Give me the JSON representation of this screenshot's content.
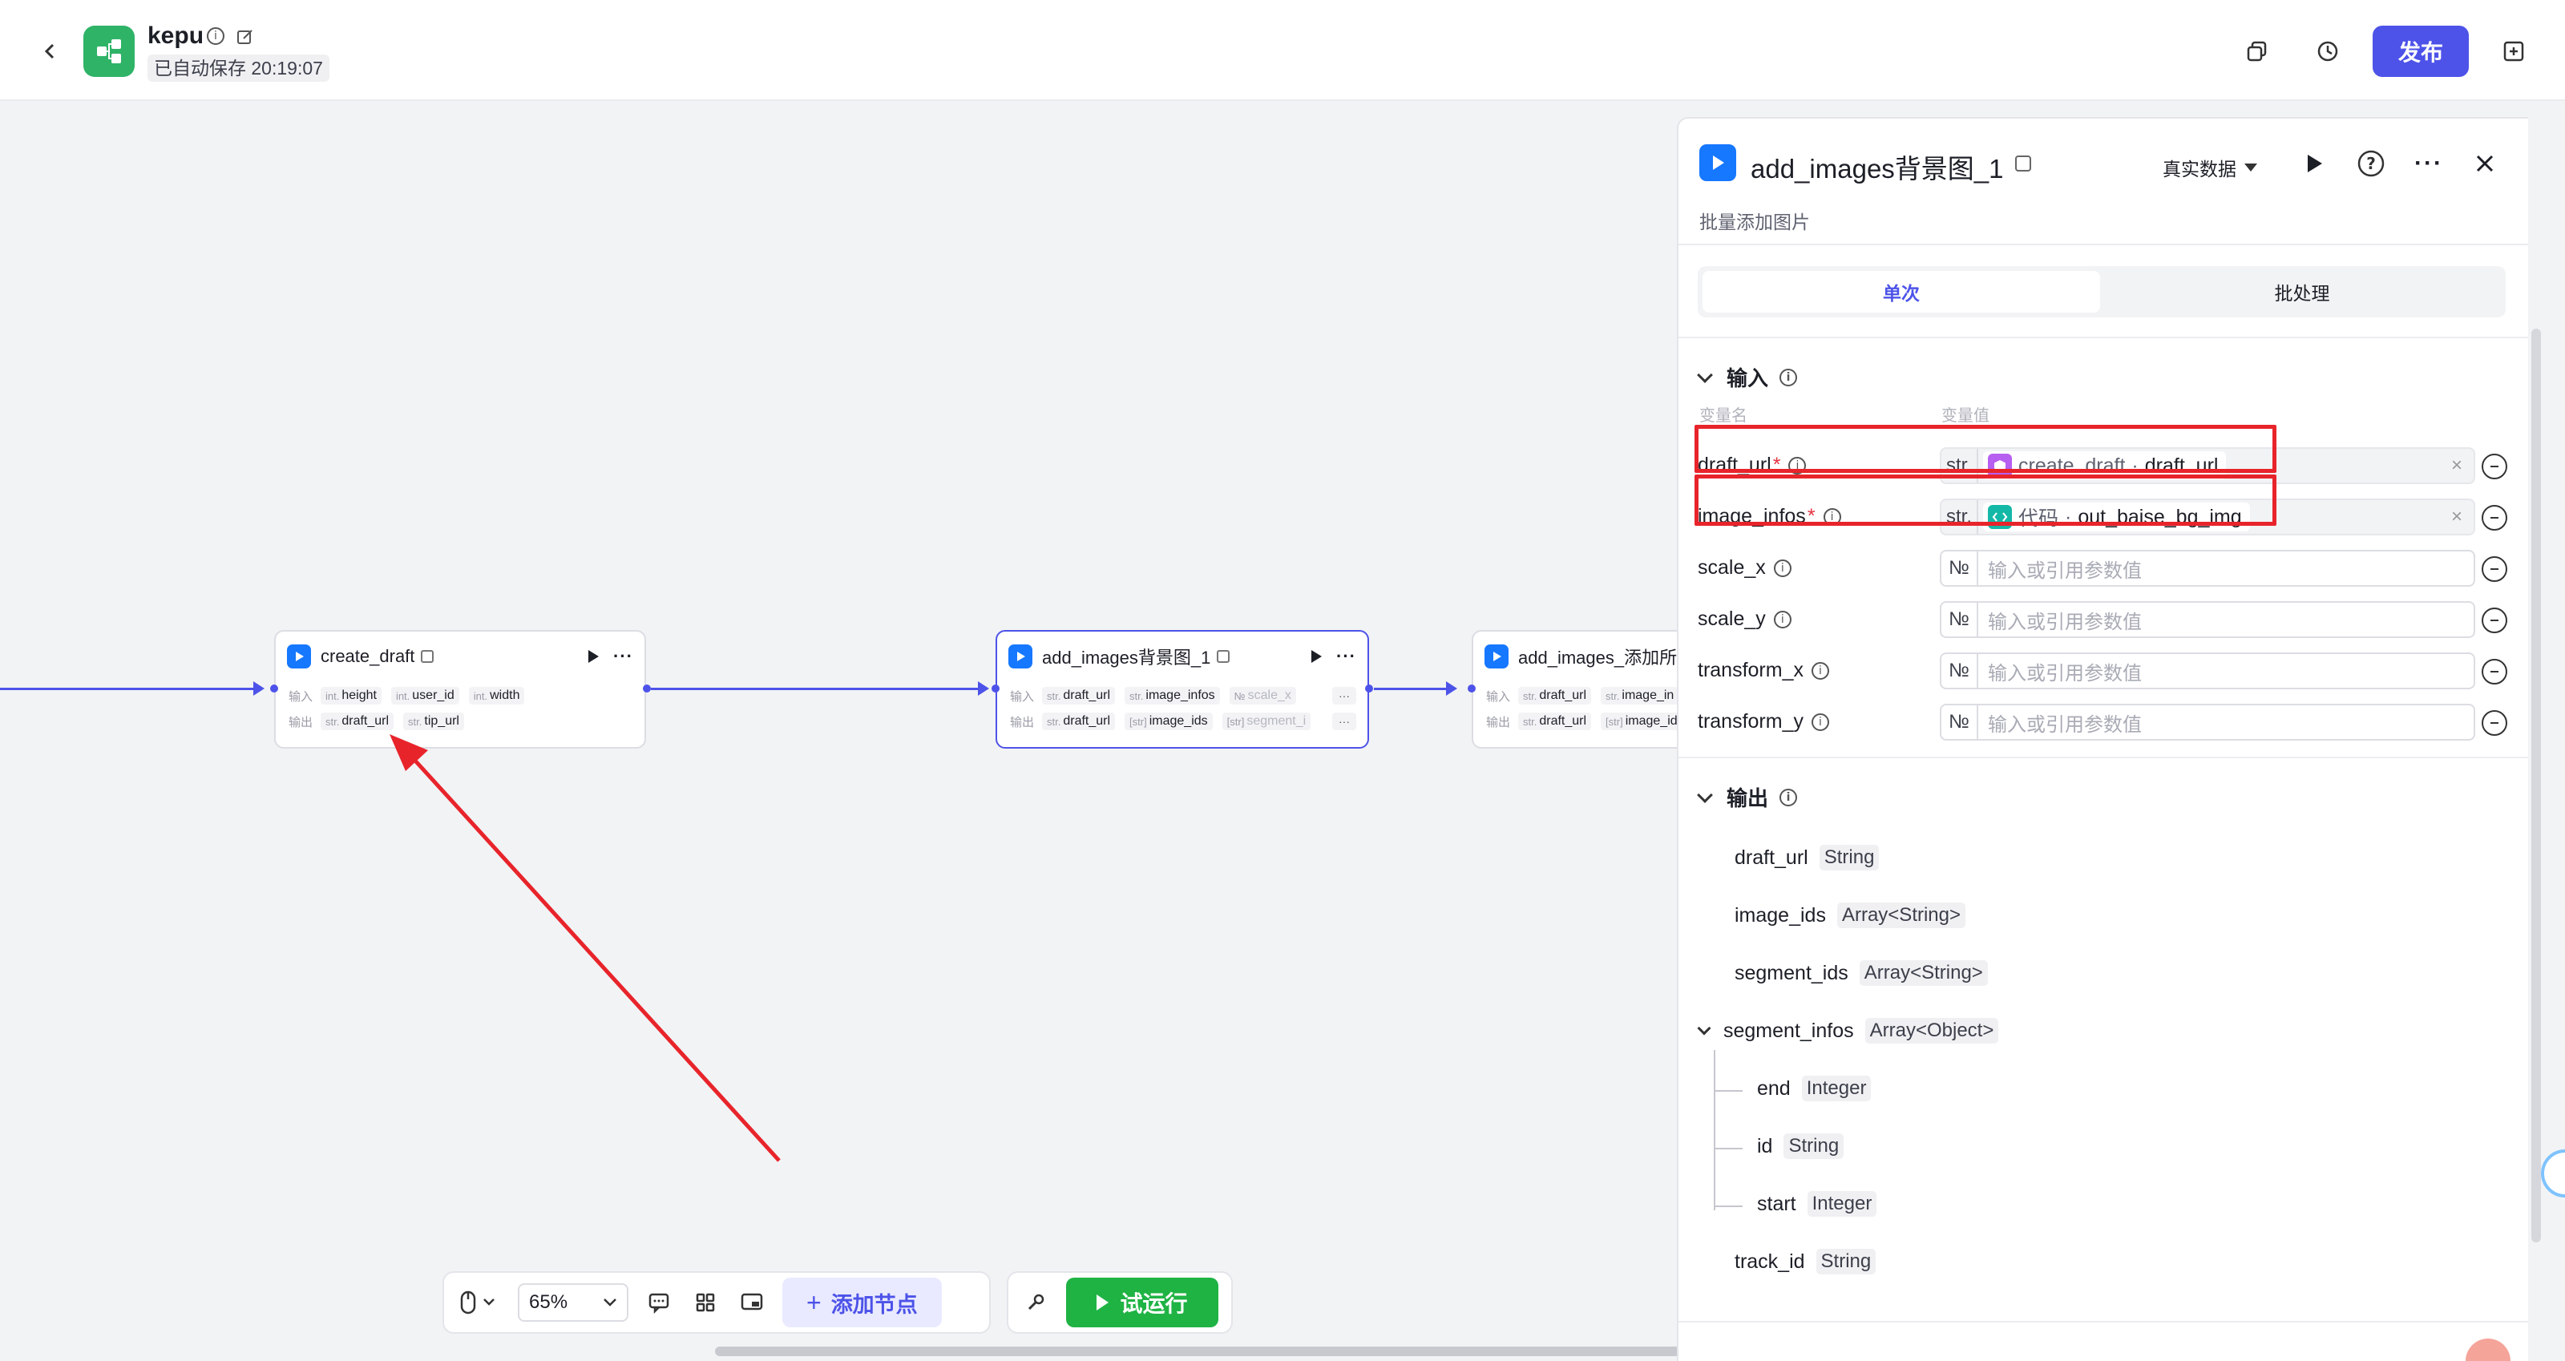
{
  "header": {
    "app_name": "kepu",
    "autosave": "已自动保存 20:19:07",
    "publish_label": "发布"
  },
  "nodes": {
    "create_draft": {
      "title": "create_draft",
      "input_label": "输入",
      "output_label": "输出",
      "inputs": [
        {
          "type": "int.",
          "name": "height"
        },
        {
          "type": "int.",
          "name": "user_id"
        },
        {
          "type": "int.",
          "name": "width"
        }
      ],
      "outputs": [
        {
          "type": "str.",
          "name": "draft_url"
        },
        {
          "type": "str.",
          "name": "tip_url"
        }
      ]
    },
    "add_images_bg": {
      "title": "add_images背景图_1",
      "input_label": "输入",
      "output_label": "输出",
      "inputs": [
        {
          "type": "str.",
          "name": "draft_url"
        },
        {
          "type": "str.",
          "name": "image_infos"
        },
        {
          "type": "№",
          "name": "scale_x"
        }
      ],
      "outputs": [
        {
          "type": "str.",
          "name": "draft_url"
        },
        {
          "type": "[str]",
          "name": "image_ids"
        },
        {
          "type": "[str]",
          "name": "segment_i"
        }
      ],
      "more": "···"
    },
    "add_images_all": {
      "title": "add_images_添加所",
      "input_label": "输入",
      "output_label": "输出",
      "inputs": [
        {
          "type": "str.",
          "name": "draft_url"
        },
        {
          "type": "str.",
          "name": "image_in"
        }
      ],
      "outputs": [
        {
          "type": "str.",
          "name": "draft_url"
        },
        {
          "type": "[str]",
          "name": "image_id"
        }
      ]
    }
  },
  "toolbar": {
    "zoom": "65%",
    "add_node": "添加节点",
    "trial_run": "试运行"
  },
  "panel": {
    "title": "add_images背景图_1",
    "description": "批量添加图片",
    "data_source": "真实数据",
    "tabs": [
      "单次",
      "批处理"
    ],
    "active_tab": "单次",
    "input_section": "输入",
    "col_name": "变量名",
    "col_value": "变量值",
    "inputs": [
      {
        "name": "draft_url",
        "required": "*",
        "type": "str.",
        "ref_node": "create_draft",
        "ref_sep": "·",
        "ref_var": "draft_url",
        "clear": "×"
      },
      {
        "name": "image_infos",
        "required": "*",
        "type": "str.",
        "ref_node": "代码",
        "ref_sep": "·",
        "ref_var": "out_baise_bg_img",
        "clear": "×"
      },
      {
        "name": "scale_x",
        "type": "№",
        "placeholder": "输入或引用参数值"
      },
      {
        "name": "scale_y",
        "type": "№",
        "placeholder": "输入或引用参数值"
      },
      {
        "name": "transform_x",
        "type": "№",
        "placeholder": "输入或引用参数值"
      },
      {
        "name": "transform_y",
        "type": "№",
        "placeholder": "输入或引用参数值"
      }
    ],
    "output_section": "输出",
    "outputs": [
      {
        "name": "draft_url",
        "type": "String"
      },
      {
        "name": "image_ids",
        "type": "Array<String>"
      },
      {
        "name": "segment_ids",
        "type": "Array<String>"
      },
      {
        "name": "segment_infos",
        "type": "Array<Object>"
      },
      {
        "name": "end",
        "type": "Integer"
      },
      {
        "name": "id",
        "type": "String"
      },
      {
        "name": "start",
        "type": "Integer"
      },
      {
        "name": "track_id",
        "type": "String"
      }
    ]
  },
  "colors": {
    "accent": "#4d53e8",
    "run_green": "#1fb344",
    "annotation_red": "#e8242b",
    "plugin_blue": "#1677ff"
  }
}
